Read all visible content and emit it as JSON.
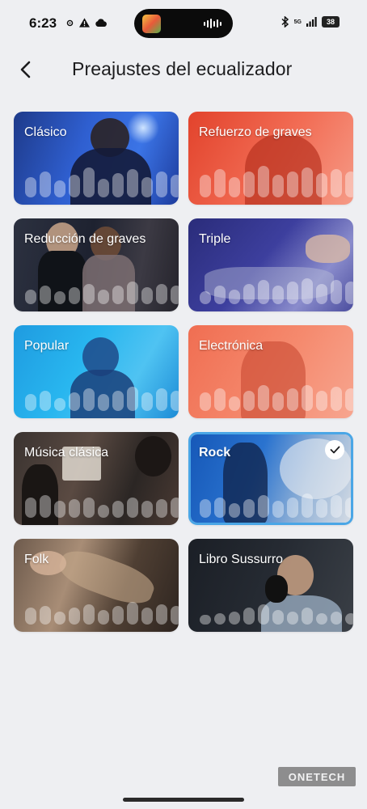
{
  "status_bar": {
    "time": "6:23",
    "battery": "38",
    "network": "5G"
  },
  "header": {
    "title": "Preajustes del ecualizador",
    "back_icon": "chevron-left-icon"
  },
  "presets": [
    {
      "label": "Clásico",
      "selected": false,
      "theme": "blue-violin",
      "levels": [
        0.55,
        0.7,
        0.45,
        0.6,
        0.8,
        0.5,
        0.65,
        0.75,
        0.55,
        0.7,
        0.6,
        0.5
      ]
    },
    {
      "label": "Refuerzo de graves",
      "selected": false,
      "theme": "red",
      "levels": [
        0.6,
        0.75,
        0.55,
        0.7,
        0.85,
        0.6,
        0.7,
        0.8,
        0.65,
        0.75,
        0.7,
        0.6
      ]
    },
    {
      "label": "Reducción de graves",
      "selected": false,
      "theme": "dark-studio",
      "levels": [
        0.4,
        0.5,
        0.35,
        0.45,
        0.55,
        0.4,
        0.5,
        0.6,
        0.45,
        0.55,
        0.5,
        0.4
      ]
    },
    {
      "label": "Triple",
      "selected": false,
      "theme": "navy-drums",
      "levels": [
        0.35,
        0.5,
        0.4,
        0.55,
        0.65,
        0.5,
        0.6,
        0.7,
        0.55,
        0.65,
        0.6,
        0.5
      ]
    },
    {
      "label": "Popular",
      "selected": false,
      "theme": "cyan",
      "levels": [
        0.45,
        0.55,
        0.35,
        0.5,
        0.6,
        0.45,
        0.55,
        0.65,
        0.5,
        0.6,
        0.55,
        0.45
      ]
    },
    {
      "label": "Electrónica",
      "selected": false,
      "theme": "coral",
      "levels": [
        0.5,
        0.6,
        0.4,
        0.55,
        0.7,
        0.5,
        0.6,
        0.7,
        0.55,
        0.65,
        0.6,
        0.5
      ]
    },
    {
      "label": "Música clásica",
      "selected": false,
      "theme": "brown-orchestra",
      "levels": [
        0.55,
        0.6,
        0.45,
        0.5,
        0.55,
        0.35,
        0.45,
        0.55,
        0.45,
        0.5,
        0.55,
        0.5
      ]
    },
    {
      "label": "Rock",
      "selected": true,
      "theme": "blue-smoke",
      "levels": [
        0.5,
        0.55,
        0.4,
        0.5,
        0.6,
        0.45,
        0.55,
        0.65,
        0.5,
        0.6,
        0.55,
        0.5
      ]
    },
    {
      "label": "Folk",
      "selected": false,
      "theme": "guitar",
      "levels": [
        0.45,
        0.5,
        0.35,
        0.45,
        0.55,
        0.4,
        0.5,
        0.6,
        0.45,
        0.55,
        0.5,
        0.45
      ]
    },
    {
      "label": "Libro Sussurro",
      "selected": false,
      "theme": "vocal",
      "levels": [
        0.25,
        0.3,
        0.35,
        0.45,
        0.55,
        0.4,
        0.35,
        0.45,
        0.3,
        0.35,
        0.3,
        0.25
      ]
    }
  ],
  "watermark": "ONETECH",
  "colors": {
    "background": "#eeeff2",
    "selected_border": "#4aa6e6"
  }
}
